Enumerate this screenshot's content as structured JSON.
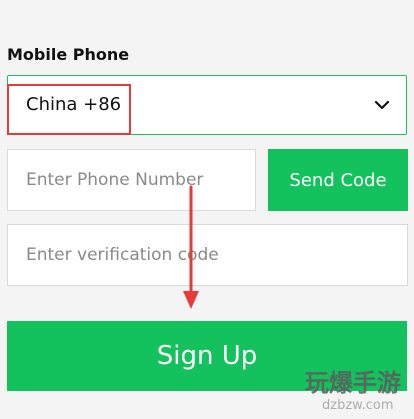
{
  "form": {
    "section_label": "Mobile Phone",
    "country_value": "China +86",
    "phone_placeholder": "Enter Phone Number",
    "send_code_label": "Send Code",
    "verification_placeholder": "Enter verification code",
    "signup_label": "Sign Up"
  },
  "icons": {
    "dropdown": "chevron-down-icon",
    "annotation_arrow": "arrow-down-icon"
  },
  "colors": {
    "accent_green": "#13c25d",
    "select_border": "#1fbe5c",
    "annotation_red": "#e53b3b"
  },
  "watermark": {
    "main": "玩爆手游",
    "sub": "dzbzw.com"
  }
}
